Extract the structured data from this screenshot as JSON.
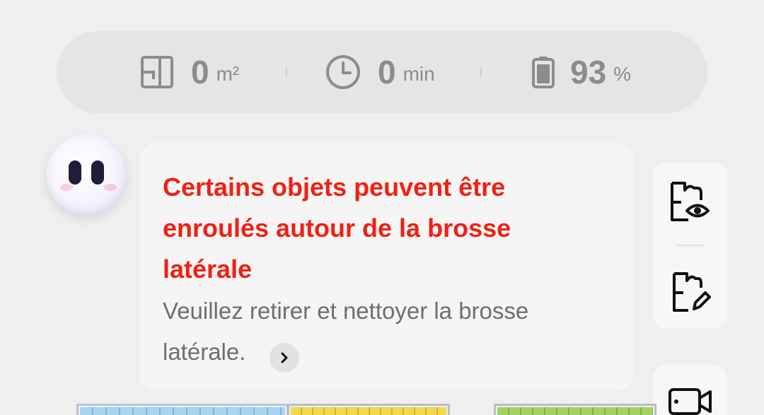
{
  "stats": {
    "area": {
      "icon": "floor-plan-icon",
      "value": "0",
      "unit": "m²"
    },
    "time": {
      "icon": "clock-icon",
      "value": "0",
      "unit": "min"
    },
    "battery": {
      "icon": "battery-icon",
      "value": "93",
      "unit": "%",
      "level": 0.93
    }
  },
  "message": {
    "title": "Certains objets peuvent être enroulés autour de la brosse latérale",
    "body": "Veuillez retirer et nettoyer la brosse latérale.",
    "detail_icon": "chevron-right-icon"
  },
  "side_actions": [
    {
      "icon": "map-view-icon"
    },
    {
      "icon": "map-edit-icon"
    },
    {
      "icon": "video-camera-icon"
    }
  ],
  "colors": {
    "alert": "#ef2113",
    "stat_text": "#8c8c8c",
    "room_blue": "#a8d4f2",
    "room_yellow": "#f2d84a",
    "room_green": "#a3d165"
  }
}
